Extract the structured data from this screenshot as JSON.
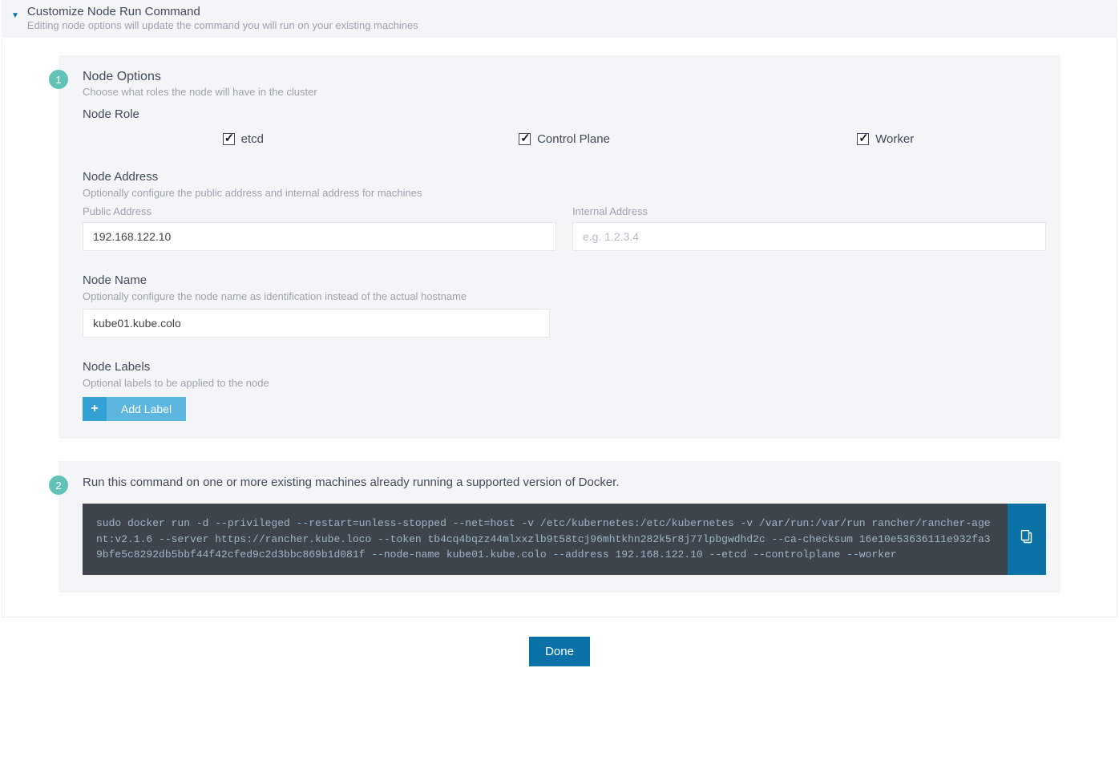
{
  "panel": {
    "title": "Customize Node Run Command",
    "subtitle": "Editing node options will update the command you will run on your existing machines"
  },
  "step1": {
    "badge": "1",
    "title": "Node Options",
    "subtitle": "Choose what roles the node will have in the cluster",
    "role_label": "Node Role",
    "roles": {
      "etcd": "etcd",
      "control_plane": "Control Plane",
      "worker": "Worker"
    },
    "address": {
      "title": "Node Address",
      "hint": "Optionally configure the public address and internal address for machines",
      "public_label": "Public Address",
      "public_value": "192.168.122.10",
      "internal_label": "Internal Address",
      "internal_placeholder": "e.g. 1.2.3.4"
    },
    "name": {
      "title": "Node Name",
      "hint": "Optionally configure the node name as identification instead of the actual hostname",
      "value": "kube01.kube.colo"
    },
    "labels": {
      "title": "Node Labels",
      "hint": "Optional labels to be applied to the node",
      "add_button": "Add Label"
    }
  },
  "step2": {
    "badge": "2",
    "title": "Run this command on one or more existing machines already running a supported version of Docker.",
    "command": "sudo docker run -d --privileged --restart=unless-stopped --net=host -v /etc/kubernetes:/etc/kubernetes -v /var/run:/var/run rancher/rancher-agent:v2.1.6 --server https://rancher.kube.loco --token tb4cq4bqzz44mlxxzlb9t58tcj96mhtkhn282k5r8j77lpbgwdhd2c --ca-checksum 16e10e53636111e932fa39bfe5c8292db5bbf44f42cfed9c2d3bbc869b1d081f --node-name kube01.kube.colo --address 192.168.122.10 --etcd --controlplane --worker"
  },
  "footer": {
    "done": "Done"
  }
}
